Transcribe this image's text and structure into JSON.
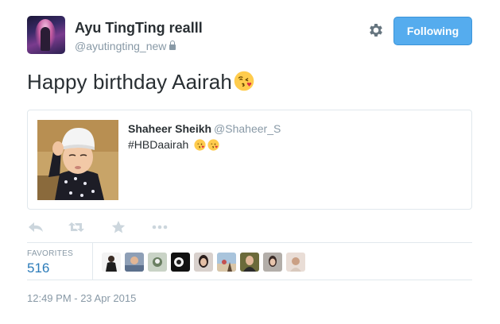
{
  "author": {
    "name": "Ayu TingTing realll",
    "handle": "@ayutingting_new",
    "protected_icon": "lock-icon"
  },
  "header": {
    "settings_icon": "gear-icon",
    "follow_button_label": "Following"
  },
  "tweet": {
    "text": "Happy birthday Aairah",
    "emoji": "kissing-face-emoji"
  },
  "quoted_tweet": {
    "author_name": "Shaheer Sheikh",
    "author_handle": "@Shaheer_S",
    "text": "#HBDaairah",
    "emojis": [
      "kissing-face-emoji",
      "kissing-face-emoji"
    ]
  },
  "actions": [
    {
      "icon": "reply-icon"
    },
    {
      "icon": "retweet-icon"
    },
    {
      "icon": "favorite-star-icon"
    },
    {
      "icon": "more-icon"
    }
  ],
  "stats": {
    "favorites_label": "FAVORITES",
    "favorites_count": "516"
  },
  "timestamp": "12:49 PM - 23 Apr 2015",
  "colors": {
    "accent": "#55acee",
    "count": "#2b7bb9",
    "muted": "#8899a6",
    "text": "#292f33",
    "border": "#e1e8ed"
  }
}
